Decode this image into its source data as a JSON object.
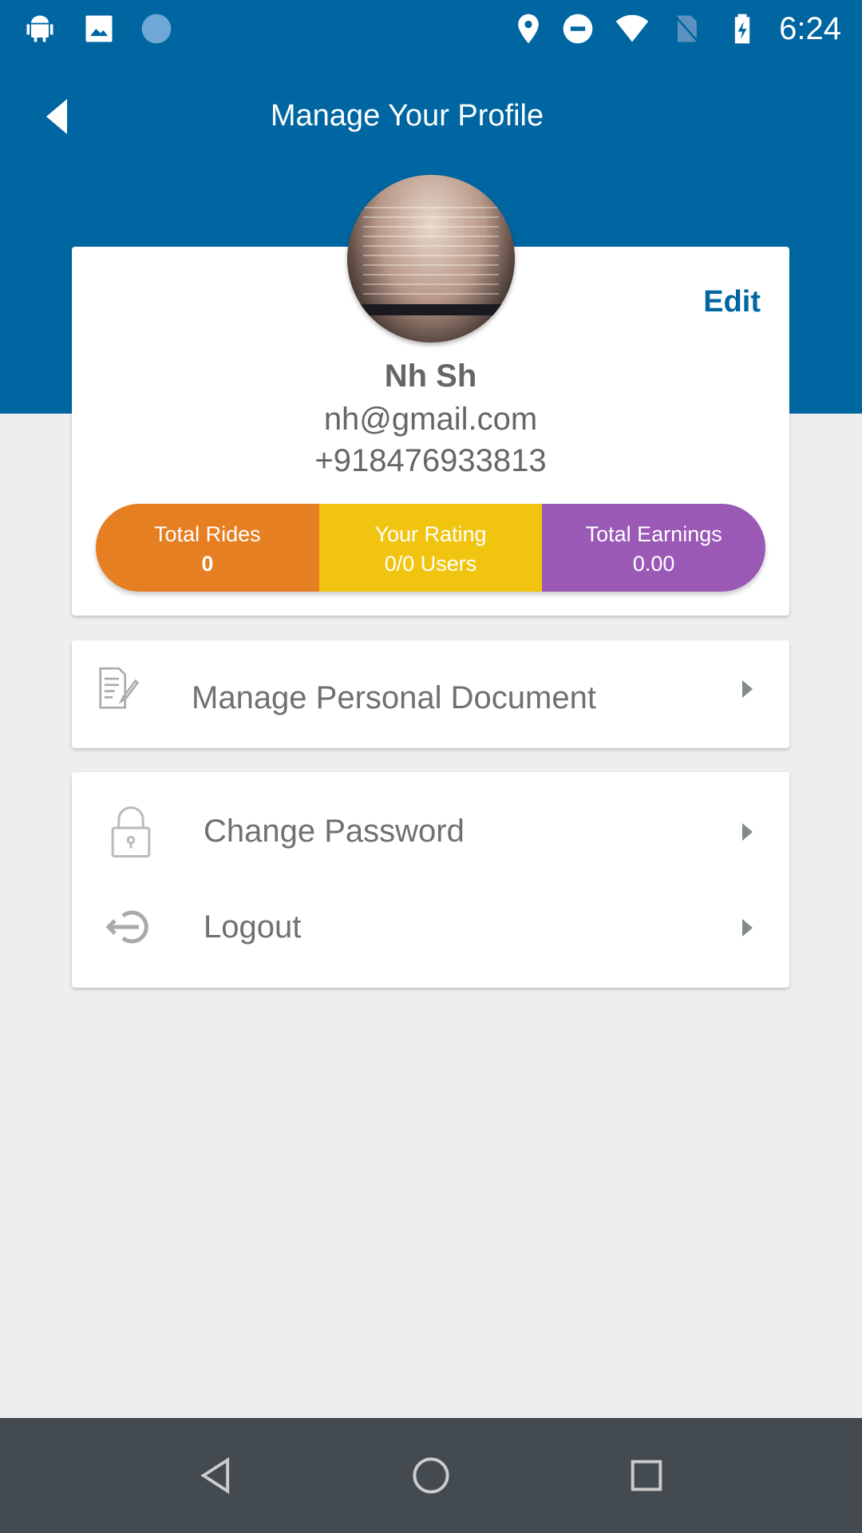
{
  "status_bar": {
    "time": "6:24",
    "icons": [
      "android-icon",
      "image-icon",
      "sync-icon",
      "location-icon",
      "do-not-disturb-icon",
      "wifi-icon",
      "no-sim-icon",
      "battery-charging-icon"
    ]
  },
  "header": {
    "title": "Manage Your Profile",
    "back_icon": "back-arrow-icon"
  },
  "profile": {
    "edit_label": "Edit",
    "name": "Nh Sh",
    "email": "nh@gmail.com",
    "phone": "+918476933813"
  },
  "stats": [
    {
      "label": "Total Rides",
      "value": "0",
      "color": "#e67e22"
    },
    {
      "label": "Your Rating",
      "value": "0/0 Users",
      "color": "#f1c40f"
    },
    {
      "label": "Total Earnings",
      "value": "0.00",
      "color": "#9b59b6"
    }
  ],
  "menu": {
    "document": {
      "label": "Manage Personal Document",
      "icon": "document-edit-icon"
    },
    "password": {
      "label": "Change Password",
      "icon": "lock-icon"
    },
    "logout": {
      "label": "Logout",
      "icon": "logout-icon"
    }
  },
  "colors": {
    "primary": "#0066a1",
    "background": "#eeeeee",
    "nav_bar": "#434a50"
  }
}
